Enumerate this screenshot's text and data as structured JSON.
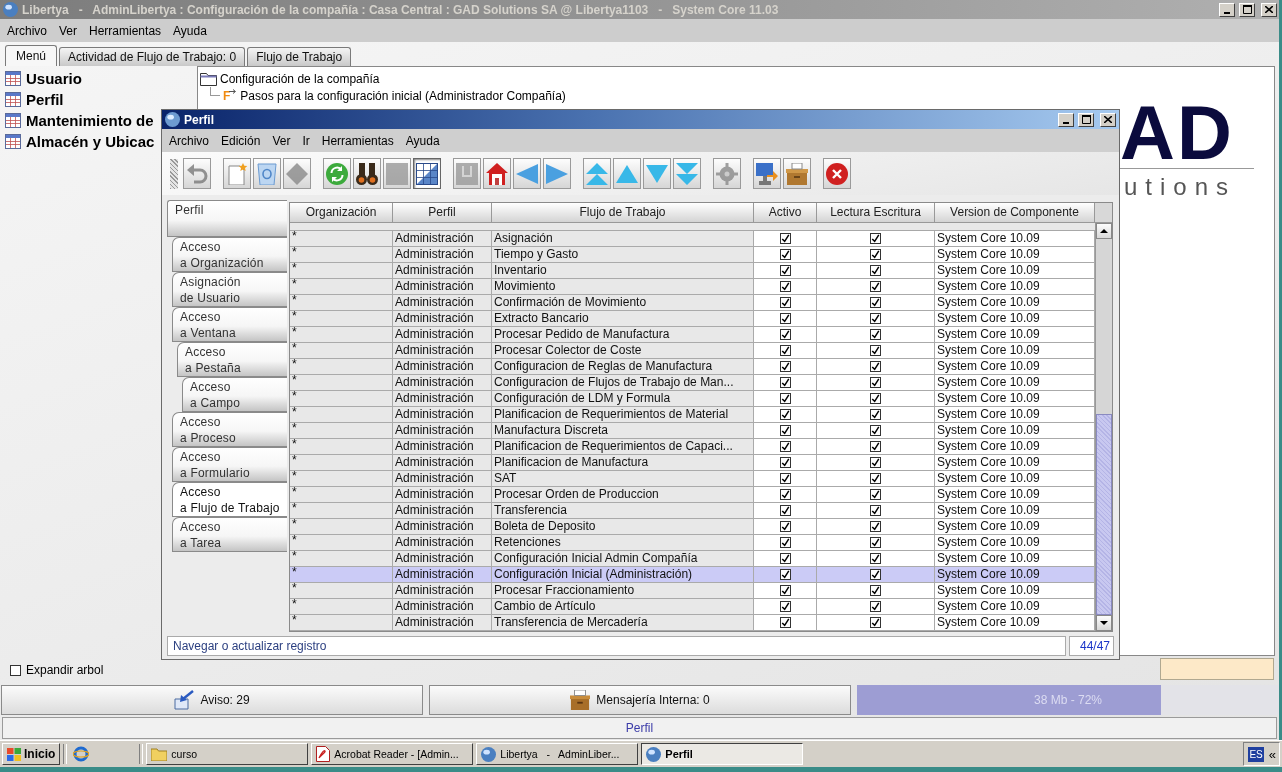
{
  "window": {
    "title": "Libertya   -   AdminLibertya : Configuración de la compañía : Casa Central : GAD Solutions SA @ Libertya1103   -   System Core 11.03"
  },
  "menu": [
    "Archivo",
    "Ver",
    "Herramientas",
    "Ayuda"
  ],
  "tabs": [
    {
      "label": "Menú",
      "selected": true
    },
    {
      "label": "Actividad de Flujo de Trabajo: 0",
      "selected": false
    },
    {
      "label": "Flujo de Trabajo",
      "selected": false
    }
  ],
  "favorites": [
    "Usuario",
    "Perfil",
    "Mantenimiento de",
    "Almacén y Ubicac"
  ],
  "tree": [
    {
      "kind": "folder",
      "label": "Configuración de la compañía",
      "children": [
        {
          "kind": "workflow",
          "icon": "F",
          "label": "Pasos para la configuración inicial (Administrador Compañía)"
        }
      ]
    }
  ],
  "logo": {
    "mark": "AD",
    "tagline": "utions"
  },
  "expand_tree": {
    "label": "Expandir arbol",
    "checked": false
  },
  "profile_window": {
    "title": "Perfil",
    "menu": [
      "Archivo",
      "Edición",
      "Ver",
      "Ir",
      "Herramientas",
      "Ayuda"
    ],
    "toolbar": [
      {
        "disabled": true,
        "pressed": false
      },
      {
        "disabled": false,
        "pressed": false
      },
      {
        "disabled": false,
        "pressed": false
      },
      {
        "disabled": true,
        "pressed": false
      },
      {
        "disabled": false,
        "pressed": false
      },
      {
        "disabled": false,
        "pressed": false
      },
      {
        "disabled": true,
        "pressed": false
      },
      {
        "disabled": false,
        "pressed": true
      },
      {
        "disabled": true,
        "pressed": false
      },
      {
        "disabled": false,
        "pressed": false
      },
      {
        "disabled": false,
        "pressed": false
      },
      {
        "disabled": false,
        "pressed": false
      },
      {
        "disabled": false,
        "pressed": false
      },
      {
        "disabled": false,
        "pressed": false
      },
      {
        "disabled": false,
        "pressed": false
      },
      {
        "disabled": false,
        "pressed": false
      },
      {
        "disabled": true,
        "pressed": false
      },
      {
        "disabled": false,
        "pressed": false
      },
      {
        "disabled": false,
        "pressed": false
      },
      {
        "disabled": false,
        "pressed": false
      }
    ],
    "record_tabs": [
      {
        "label": "Perfil",
        "selected": false,
        "children": [
          {
            "label": "Acceso\na Organización",
            "selected": false
          },
          {
            "label": "Asignación\nde Usuario",
            "selected": false
          },
          {
            "label": "Acceso\na Ventana",
            "selected": false,
            "children": [
              {
                "label": "Acceso\na Pestaña",
                "selected": false,
                "children": [
                  {
                    "label": "Acceso\na Campo",
                    "selected": false
                  }
                ]
              }
            ]
          },
          {
            "label": "Acceso\na Proceso",
            "selected": false
          },
          {
            "label": "Acceso\na Formulario",
            "selected": false
          },
          {
            "label": "Acceso\na Flujo de Trabajo",
            "selected": true
          },
          {
            "label": "Acceso\na Tarea",
            "selected": false
          }
        ]
      }
    ],
    "table": {
      "columns": [
        "Organización",
        "Perfil",
        "Flujo de Trabajo",
        "Activo",
        "Lectura Escritura",
        "Version de Componente"
      ],
      "rows": [
        {
          "organization": "*",
          "profile": "Administración",
          "workflow": "Asignación",
          "active": true,
          "read_write": true,
          "version": "System Core 10.09",
          "selected": false
        },
        {
          "organization": "*",
          "profile": "Administración",
          "workflow": "Tiempo y Gasto",
          "active": true,
          "read_write": true,
          "version": "System Core 10.09",
          "selected": false
        },
        {
          "organization": "*",
          "profile": "Administración",
          "workflow": "Inventario",
          "active": true,
          "read_write": true,
          "version": "System Core 10.09",
          "selected": false
        },
        {
          "organization": "*",
          "profile": "Administración",
          "workflow": "Movimiento",
          "active": true,
          "read_write": true,
          "version": "System Core 10.09",
          "selected": false
        },
        {
          "organization": "*",
          "profile": "Administración",
          "workflow": "Confirmación de Movimiento",
          "active": true,
          "read_write": true,
          "version": "System Core 10.09",
          "selected": false
        },
        {
          "organization": "*",
          "profile": "Administración",
          "workflow": "Extracto Bancario",
          "active": true,
          "read_write": true,
          "version": "System Core 10.09",
          "selected": false
        },
        {
          "organization": "*",
          "profile": "Administración",
          "workflow": "Procesar Pedido de Manufactura",
          "active": true,
          "read_write": true,
          "version": "System Core 10.09",
          "selected": false
        },
        {
          "organization": "*",
          "profile": "Administración",
          "workflow": "Procesar Colector de Coste",
          "active": true,
          "read_write": true,
          "version": "System Core 10.09",
          "selected": false
        },
        {
          "organization": "*",
          "profile": "Administración",
          "workflow": "Configuracion de Reglas de Manufactura",
          "active": true,
          "read_write": true,
          "version": "System Core 10.09",
          "selected": false
        },
        {
          "organization": "*",
          "profile": "Administración",
          "workflow": "Configuracion de Flujos de Trabajo de Man...",
          "active": true,
          "read_write": true,
          "version": "System Core 10.09",
          "selected": false
        },
        {
          "organization": "*",
          "profile": "Administración",
          "workflow": "Configuración de LDM y Formula",
          "active": true,
          "read_write": true,
          "version": "System Core 10.09",
          "selected": false
        },
        {
          "organization": "*",
          "profile": "Administración",
          "workflow": "Planificacion de Requerimientos de Material",
          "active": true,
          "read_write": true,
          "version": "System Core 10.09",
          "selected": false
        },
        {
          "organization": "*",
          "profile": "Administración",
          "workflow": "Manufactura Discreta",
          "active": true,
          "read_write": true,
          "version": "System Core 10.09",
          "selected": false
        },
        {
          "organization": "*",
          "profile": "Administración",
          "workflow": "Planificacion de Requerimientos de Capaci...",
          "active": true,
          "read_write": true,
          "version": "System Core 10.09",
          "selected": false
        },
        {
          "organization": "*",
          "profile": "Administración",
          "workflow": "Planificacion de Manufactura",
          "active": true,
          "read_write": true,
          "version": "System Core 10.09",
          "selected": false
        },
        {
          "organization": "*",
          "profile": "Administración",
          "workflow": "SAT",
          "active": true,
          "read_write": true,
          "version": "System Core 10.09",
          "selected": false
        },
        {
          "organization": "*",
          "profile": "Administración",
          "workflow": "Procesar Orden de Produccion",
          "active": true,
          "read_write": true,
          "version": "System Core 10.09",
          "selected": false
        },
        {
          "organization": "*",
          "profile": "Administración",
          "workflow": "Transferencia",
          "active": true,
          "read_write": true,
          "version": "System Core 10.09",
          "selected": false
        },
        {
          "organization": "*",
          "profile": "Administración",
          "workflow": "Boleta de Deposito",
          "active": true,
          "read_write": true,
          "version": "System Core 10.09",
          "selected": false
        },
        {
          "organization": "*",
          "profile": "Administración",
          "workflow": "Retenciones",
          "active": true,
          "read_write": true,
          "version": "System Core 10.09",
          "selected": false
        },
        {
          "organization": "*",
          "profile": "Administración",
          "workflow": "Configuración Inicial Admin Compañía",
          "active": true,
          "read_write": true,
          "version": "System Core 10.09",
          "selected": false
        },
        {
          "organization": "*",
          "profile": "Administración",
          "workflow": "Configuración Inicial (Administración)",
          "active": true,
          "read_write": true,
          "version": "System Core 10.09",
          "selected": true
        },
        {
          "organization": "*",
          "profile": "Administración",
          "workflow": "Procesar Fraccionamiento",
          "active": true,
          "read_write": true,
          "version": "System Core 10.09",
          "selected": false
        },
        {
          "organization": "*",
          "profile": "Administración",
          "workflow": "Cambio de Artículo",
          "active": true,
          "read_write": true,
          "version": "System Core 10.09",
          "selected": false
        },
        {
          "organization": "*",
          "profile": "Administración",
          "workflow": "Transferencia de Mercadería",
          "active": true,
          "read_write": true,
          "version": "System Core 10.09",
          "selected": false
        }
      ]
    },
    "status": {
      "message": "Navegar o actualizar registro",
      "record": "44/47"
    }
  },
  "bottom_bar": {
    "notices": "Aviso: 29",
    "messages": "Mensajería Interna: 0",
    "memory": {
      "reading": "38 Mb - 72%",
      "level": 0.72
    }
  },
  "status_line": "Perfil",
  "taskbar": {
    "start": "Inicio",
    "tasks": [
      {
        "kind": "folder",
        "label": "curso",
        "selected": false
      },
      {
        "kind": "document",
        "label": "Acrobat Reader - [Admin...",
        "selected": false
      },
      {
        "kind": "app",
        "label": "Libertya   -   AdminLiber...",
        "selected": false
      },
      {
        "kind": "app",
        "label": "Perfil",
        "selected": true
      }
    ],
    "language": "ES",
    "tray_toggle": "«"
  }
}
